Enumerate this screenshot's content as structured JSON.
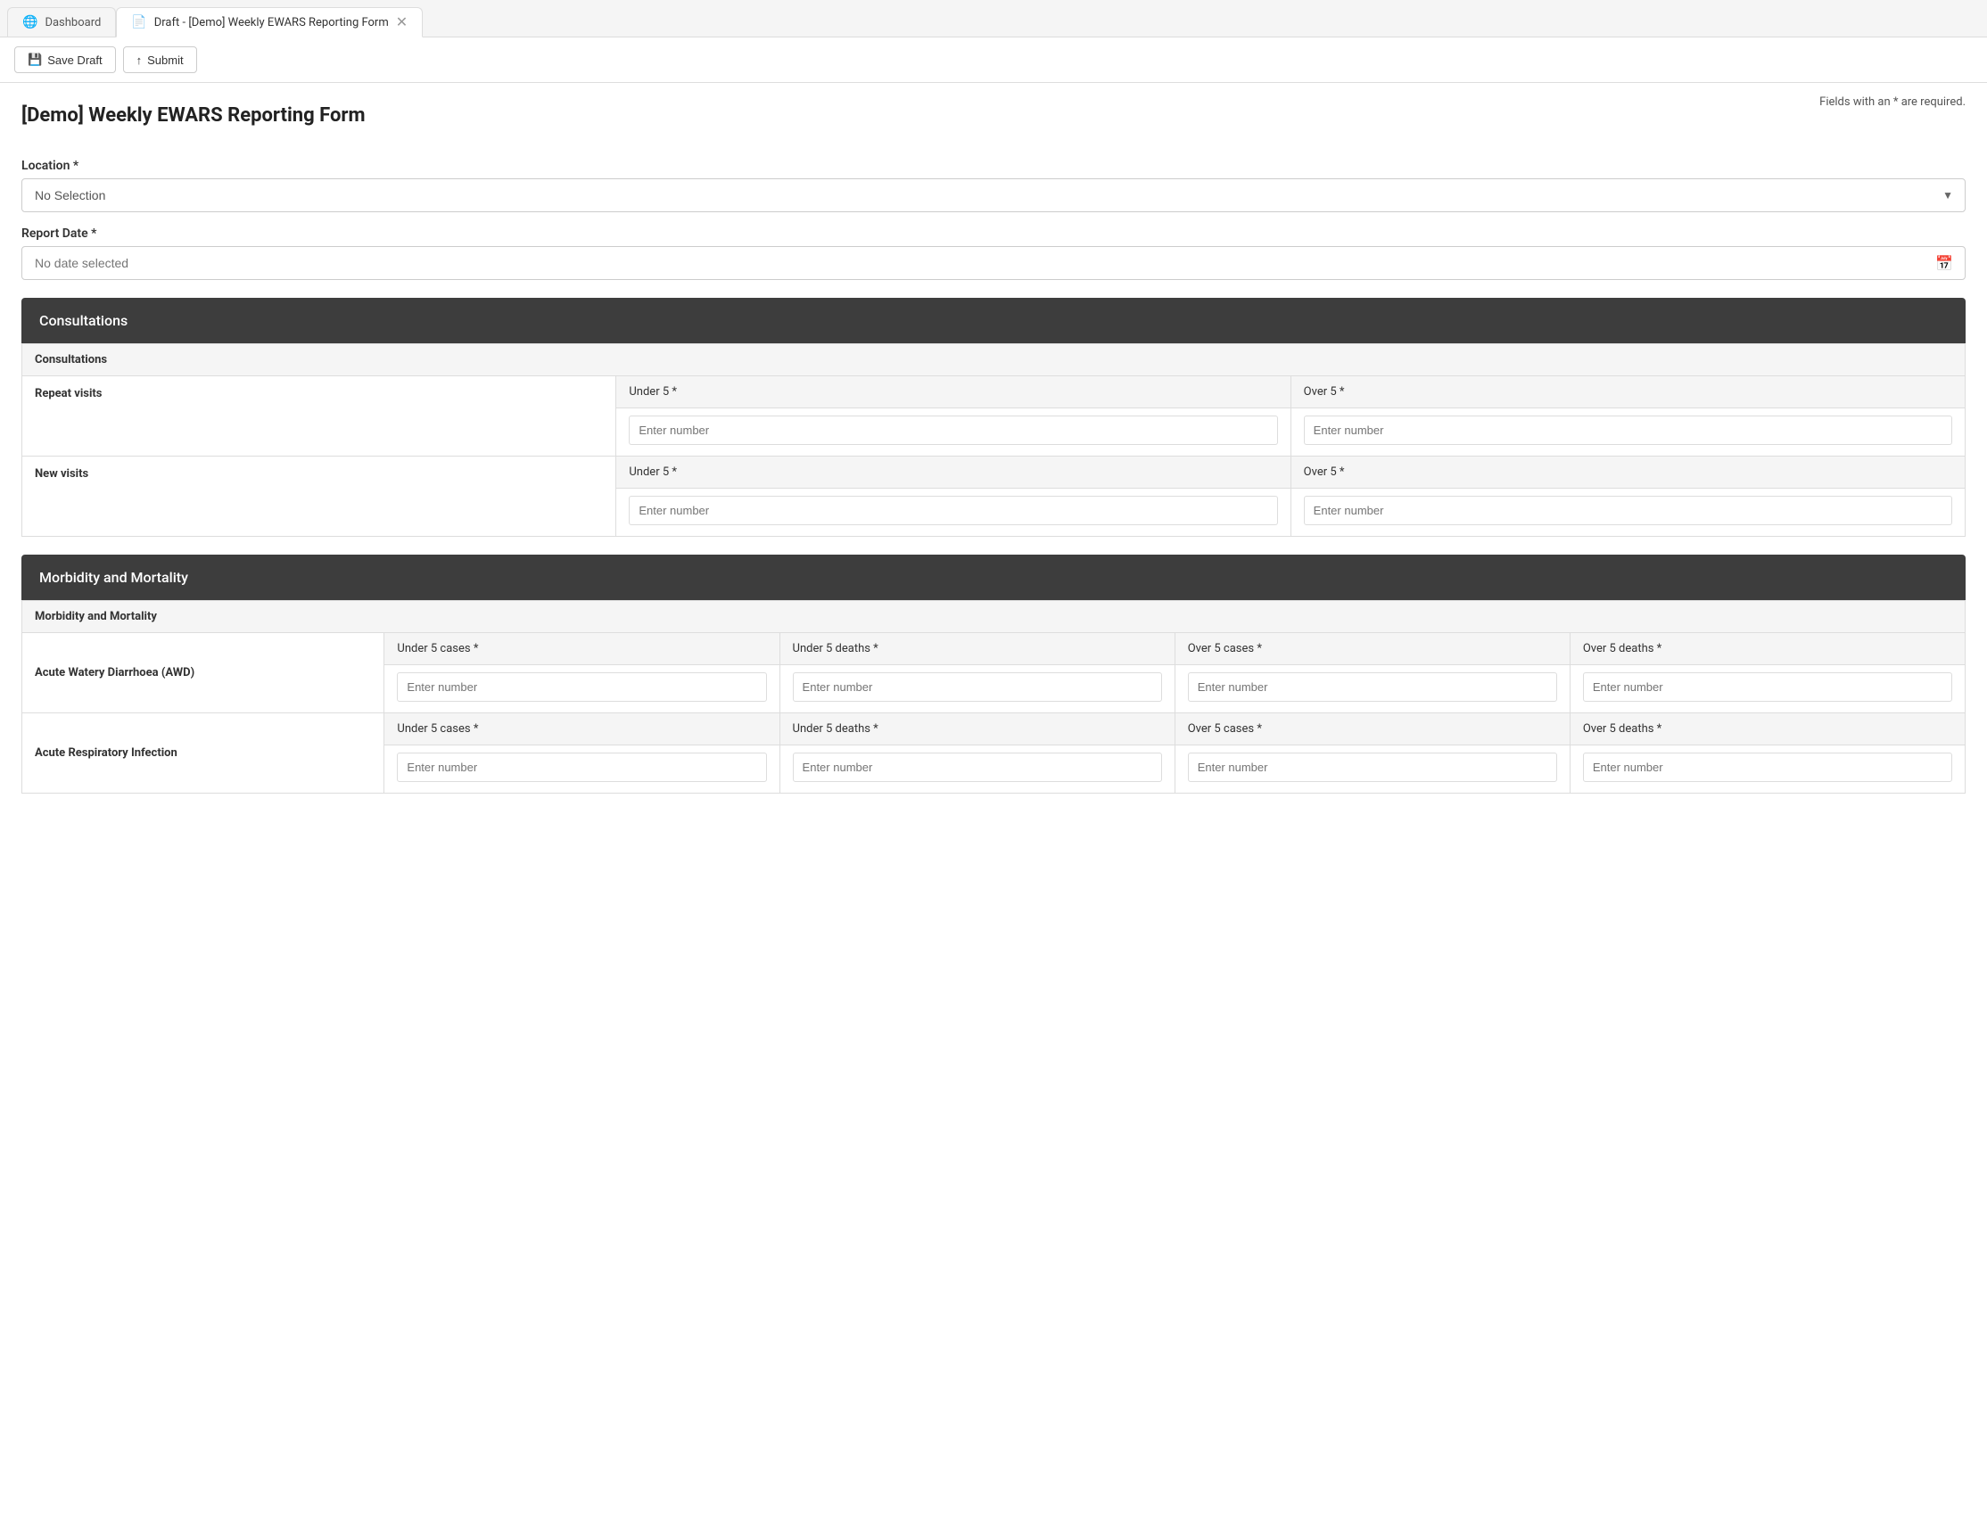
{
  "browser": {
    "tabs": [
      {
        "id": "dashboard",
        "label": "Dashboard",
        "icon": "🌐",
        "active": false,
        "closable": false
      },
      {
        "id": "form",
        "label": "Draft - [Demo] Weekly EWARS Reporting Form",
        "icon": "📄",
        "active": true,
        "closable": true
      }
    ]
  },
  "toolbar": {
    "save_draft_label": "Save Draft",
    "submit_label": "Submit"
  },
  "page": {
    "title": "[Demo] Weekly EWARS Reporting Form",
    "required_note": "Fields with an * are required."
  },
  "location_field": {
    "label": "Location *",
    "placeholder": "No Selection"
  },
  "report_date_field": {
    "label": "Report Date *",
    "placeholder": "No date selected"
  },
  "consultations_section": {
    "header": "Consultations",
    "table_header": "Consultations",
    "rows": [
      {
        "label": "Repeat visits",
        "fields": [
          {
            "label": "Under 5 *",
            "placeholder": "Enter number"
          },
          {
            "label": "Over 5 *",
            "placeholder": "Enter number"
          }
        ]
      },
      {
        "label": "New visits",
        "fields": [
          {
            "label": "Under 5 *",
            "placeholder": "Enter number"
          },
          {
            "label": "Over 5 *",
            "placeholder": "Enter number"
          }
        ]
      }
    ]
  },
  "morbidity_section": {
    "header": "Morbidity and Mortality",
    "table_header": "Morbidity and Mortality",
    "rows": [
      {
        "label": "Acute Watery Diarrhoea (AWD)",
        "fields": [
          {
            "label": "Under 5 cases *",
            "placeholder": "Enter number"
          },
          {
            "label": "Under 5 deaths *",
            "placeholder": "Enter number"
          },
          {
            "label": "Over 5 cases *",
            "placeholder": "Enter number"
          },
          {
            "label": "Over 5 deaths *",
            "placeholder": "Enter number"
          }
        ]
      },
      {
        "label": "Acute Respiratory Infection",
        "fields": [
          {
            "label": "Under 5 cases *",
            "placeholder": "Enter number"
          },
          {
            "label": "Under 5 deaths *",
            "placeholder": "Enter number"
          },
          {
            "label": "Over 5 cases *",
            "placeholder": "Enter number"
          },
          {
            "label": "Over 5 deaths *",
            "placeholder": "Enter number"
          }
        ]
      }
    ]
  }
}
